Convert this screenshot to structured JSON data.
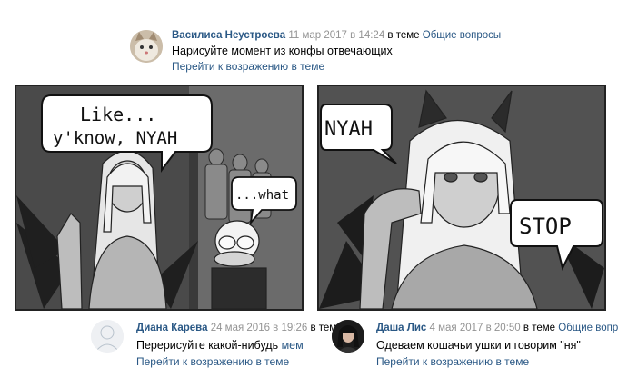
{
  "comments": [
    {
      "author": "Василиса Неустроева",
      "date": "11 мар 2017 в 14:24",
      "in_topic": "в теме",
      "topic": "Общие вопросы",
      "text": "Нарисуйте момент из конфы отвечающих",
      "reply": "Перейти к возражению в теме"
    },
    {
      "author": "Диана Карева",
      "date": "24 мая 2016 в 19:26",
      "in_topic": "в теме",
      "text_before": "Перерисуйте какой-нибудь",
      "text_tag": "мем",
      "reply": "Перейти к возражению в теме"
    },
    {
      "author": "Даша Лис",
      "date": "4 мая 2017 в 20:50",
      "in_topic": "в теме",
      "topic": "Общие вопросы",
      "text": "Одеваем кошачьи ушки и говорим \"ня\"",
      "reply": "Перейти к возражению в теме"
    }
  ],
  "comic": {
    "left_panel": {
      "bubble_main_line1": "Like...",
      "bubble_main_line2": "y'know, NYAH",
      "bubble_side": "...what"
    },
    "right_panel": {
      "bubble_left": "NYAH",
      "bubble_right": "STOP"
    }
  },
  "colors": {
    "link": "#2a5885",
    "meta_gray": "#939393",
    "panel_bg": "#555555"
  }
}
